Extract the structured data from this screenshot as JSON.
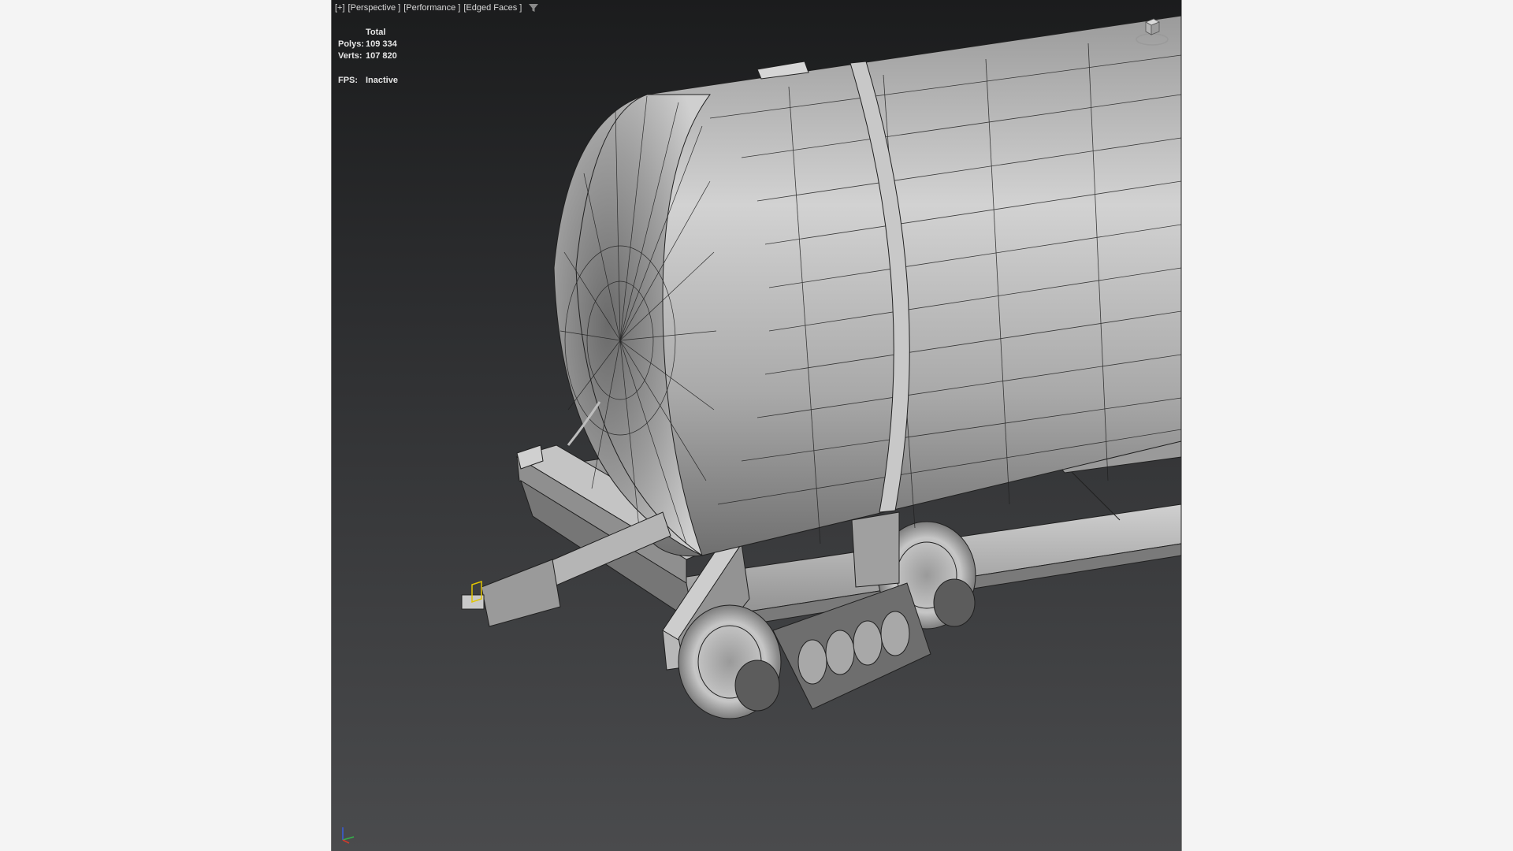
{
  "viewport": {
    "menu": {
      "plus": "[+]",
      "view_mode": "[Perspective ]",
      "performance": "[Performance ]",
      "shading": "[Edged Faces ]"
    },
    "stats": {
      "header": "Total",
      "polys_label": "Polys:",
      "polys_value": "109 334",
      "verts_label": "Verts:",
      "verts_value": "107 820",
      "fps_label": "FPS:",
      "fps_value": "Inactive"
    },
    "icons": {
      "filter": "filter-icon",
      "viewcube": "viewcube-icon",
      "axis": "axis-tripod-icon"
    },
    "colors": {
      "background_top": "#1b1c1d",
      "background_bottom": "#4a4b4d",
      "model": "#b9b9b9",
      "wire": "#202020",
      "selection": "#e0c400",
      "axis_x": "#d23a2a",
      "axis_y": "#35b24a",
      "axis_z": "#3a5bd6"
    }
  }
}
